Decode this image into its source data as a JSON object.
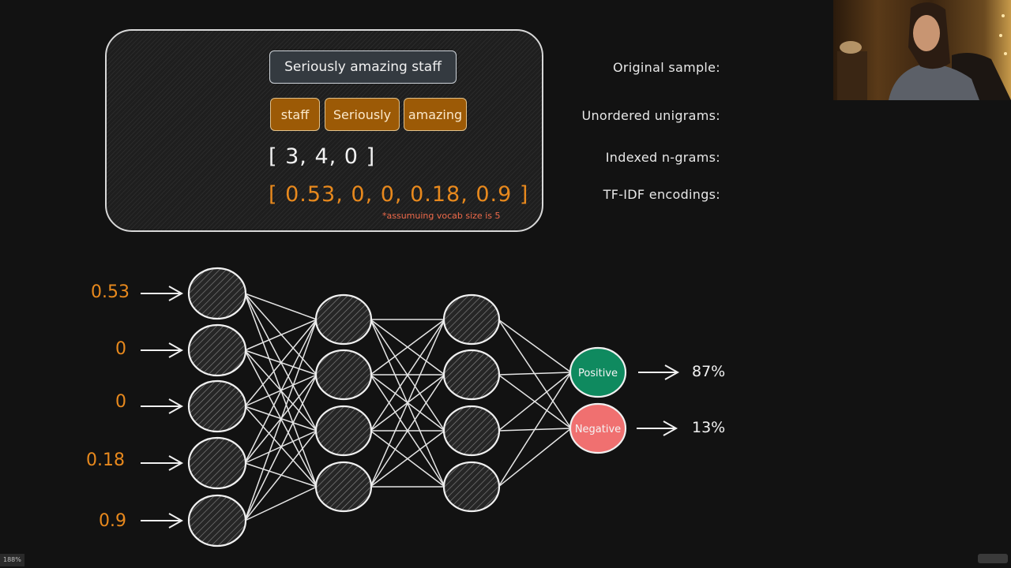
{
  "card": {
    "rows": [
      {
        "label": "Original sample:"
      },
      {
        "label": "Unordered unigrams:"
      },
      {
        "label": "Indexed n-grams:"
      },
      {
        "label": "TF-IDF encodings:"
      }
    ],
    "original_sample": "Seriously amazing staff",
    "unigrams": [
      "staff",
      "Seriously",
      "amazing"
    ],
    "indexed_ngrams": "[ 3, 4, 0 ]",
    "tfidf_encodings": "[ 0.53, 0, 0, 0.18, 0.9 ]",
    "footnote": "*assumuing vocab size is 5"
  },
  "network": {
    "inputs": [
      "0.53",
      "0",
      "0",
      "0.18",
      "0.9"
    ],
    "layers": [
      5,
      4,
      4,
      2
    ],
    "outputs": [
      {
        "label": "Positive",
        "probability": "87%",
        "color": "#0f8a5f"
      },
      {
        "label": "Negative",
        "probability": "13%",
        "color": "#f07070"
      }
    ],
    "accent_orange": "#e8891d"
  },
  "status": {
    "zoom_level": "188%"
  },
  "webcam": {
    "icon": "presenter-video"
  }
}
